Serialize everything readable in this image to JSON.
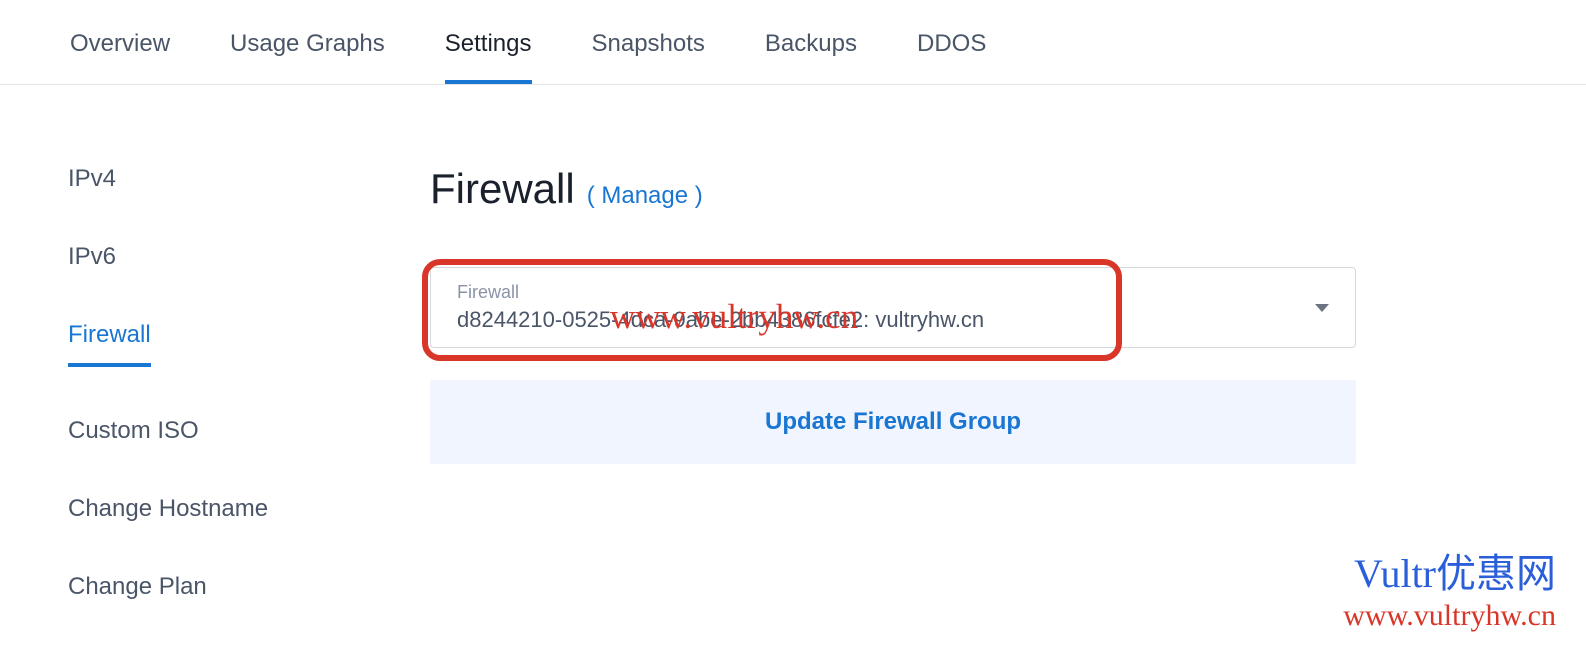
{
  "topTabs": {
    "overview": "Overview",
    "usageGraphs": "Usage Graphs",
    "settings": "Settings",
    "snapshots": "Snapshots",
    "backups": "Backups",
    "ddos": "DDOS"
  },
  "sidebar": {
    "ipv4": "IPv4",
    "ipv6": "IPv6",
    "firewall": "Firewall",
    "customIso": "Custom ISO",
    "changeHostname": "Change Hostname",
    "changePlan": "Change Plan"
  },
  "heading": {
    "title": "Firewall",
    "manage": "( Manage )"
  },
  "dropdown": {
    "label": "Firewall",
    "value": "d8244210-0525-4dca-9abe-2bb4386fcfe2: vultryhw.cn"
  },
  "button": {
    "update": "Update Firewall Group"
  },
  "watermark": {
    "overlay": "www.vultryhw.cn",
    "cornerLine1": "Vultr优惠网",
    "cornerLine2": "www.vultryhw.cn"
  },
  "colors": {
    "accent": "#1976d2",
    "highlight": "#d9362a"
  }
}
